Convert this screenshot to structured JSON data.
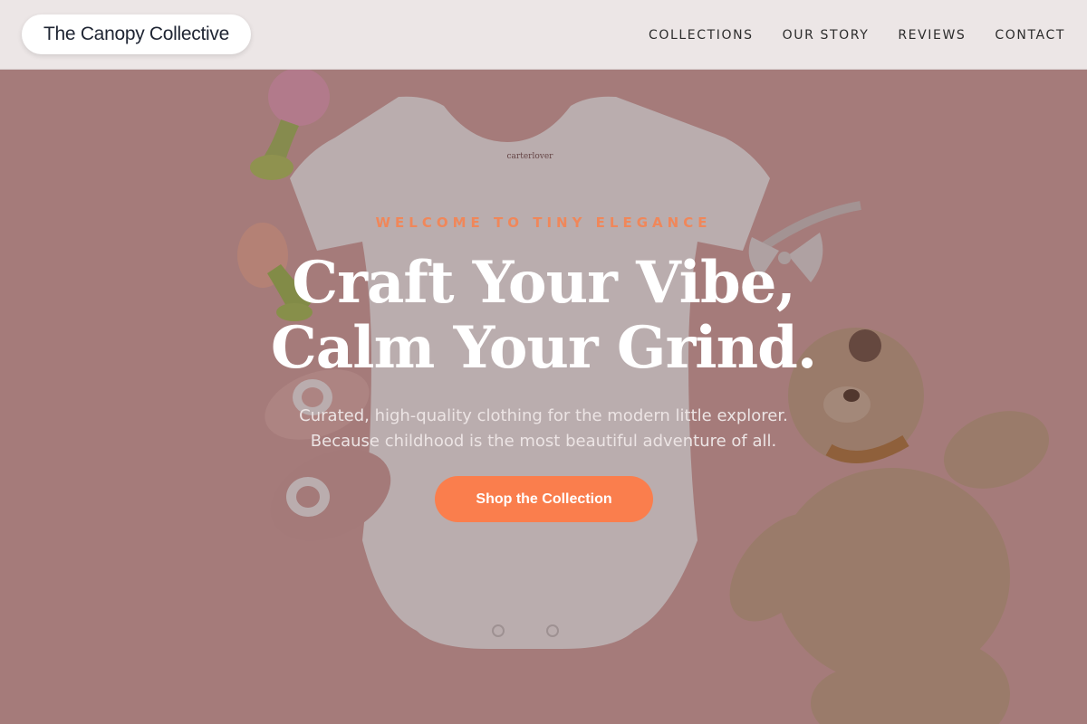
{
  "brand": {
    "name": "The Canopy Collective"
  },
  "nav": {
    "items": [
      {
        "label": "COLLECTIONS"
      },
      {
        "label": "OUR STORY"
      },
      {
        "label": "REVIEWS"
      },
      {
        "label": "CONTACT"
      }
    ]
  },
  "hero": {
    "eyebrow": "WELCOME TO TINY ELEGANCE",
    "headline_line1": "Craft Your Vibe,",
    "headline_line2": "Calm Your Grind.",
    "subtext_line1": "Curated, high-quality clothing for the modern little explorer.",
    "subtext_line2": "Because childhood is the most beautiful adventure of all.",
    "cta_label": "Shop the Collection",
    "onesie_tag": "carterlover"
  },
  "colors": {
    "accent": "#fa7e4d",
    "eyebrow": "#f0875a",
    "header_bg": "#ece6e6",
    "hero_bg": "#dba9a6"
  },
  "icons": [
    "teether-image",
    "onesie-image",
    "bow-headband-image",
    "booties-image",
    "teddy-bear-image"
  ]
}
